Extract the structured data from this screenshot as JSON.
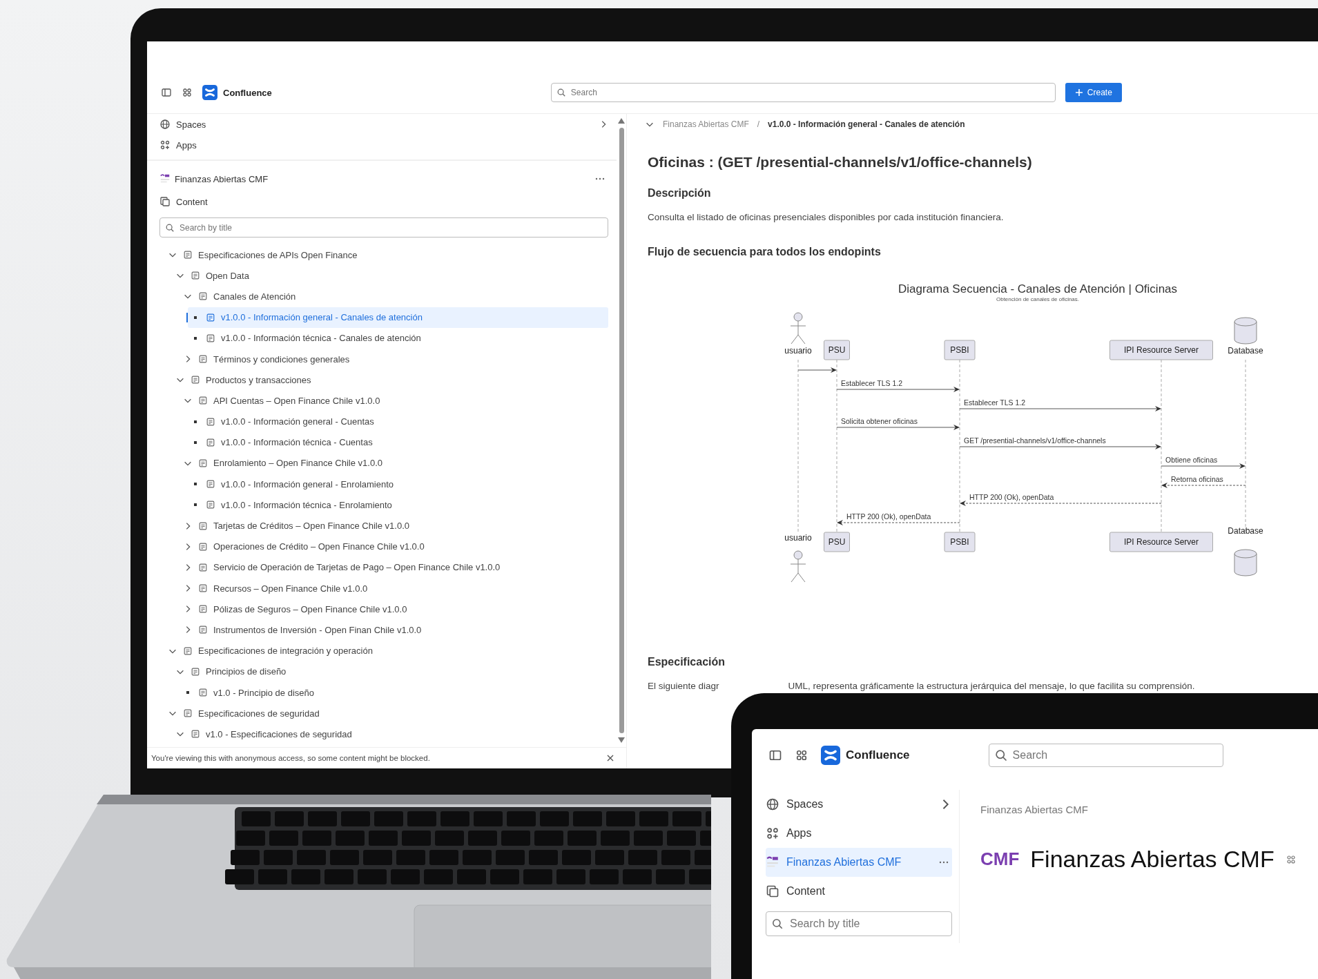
{
  "laptop": {
    "header": {
      "product": "Confluence",
      "search_placeholder": "Search",
      "create_label": "Create"
    },
    "sidebar": {
      "nav": [
        {
          "label": "Spaces",
          "kind": "spaces"
        },
        {
          "label": "Apps",
          "kind": "apps"
        }
      ],
      "space": {
        "name": "Finanzas Abiertas CMF",
        "selected": false
      },
      "content_label": "Content",
      "search_placeholder": "Search by title",
      "tree": [
        {
          "label": "Especificaciones de APIs Open Finance",
          "kind": "branch",
          "expanded": true,
          "selected": false,
          "children": [
            {
              "label": "Open Data",
              "kind": "branch",
              "expanded": true,
              "selected": false,
              "children": [
                {
                  "label": "Canales de Atención",
                  "kind": "branch",
                  "expanded": true,
                  "selected": false,
                  "children": [
                    {
                      "label": "v1.0.0 - Información general - Canales de atención",
                      "kind": "leaf",
                      "selected": true
                    },
                    {
                      "label": "v1.0.0 - Información técnica - Canales de atención",
                      "kind": "leaf",
                      "selected": false
                    }
                  ]
                },
                {
                  "label": "Términos y condiciones generales",
                  "kind": "branch",
                  "expanded": false,
                  "selected": false
                }
              ]
            },
            {
              "label": "Productos y transacciones",
              "kind": "branch",
              "expanded": true,
              "selected": false,
              "children": [
                {
                  "label": "API Cuentas – Open Finance Chile v1.0.0",
                  "kind": "branch",
                  "expanded": true,
                  "selected": false,
                  "children": [
                    {
                      "label": "v1.0.0 - Información general - Cuentas",
                      "kind": "leaf",
                      "selected": false
                    },
                    {
                      "label": "v1.0.0 - Información técnica - Cuentas",
                      "kind": "leaf",
                      "selected": false
                    }
                  ]
                },
                {
                  "label": "Enrolamiento – Open Finance Chile v1.0.0",
                  "kind": "branch",
                  "expanded": true,
                  "selected": false,
                  "children": [
                    {
                      "label": "v1.0.0 - Información general - Enrolamiento",
                      "kind": "leaf",
                      "selected": false
                    },
                    {
                      "label": "v1.0.0 - Información técnica - Enrolamiento",
                      "kind": "leaf",
                      "selected": false
                    }
                  ]
                },
                {
                  "label": "Tarjetas de Créditos – Open Finance Chile v1.0.0",
                  "kind": "branch",
                  "expanded": false,
                  "selected": false
                },
                {
                  "label": "Operaciones de Crédito – Open Finance Chile v1.0.0",
                  "kind": "branch",
                  "expanded": false,
                  "selected": false
                },
                {
                  "label": "Servicio de Operación de Tarjetas de Pago – Open Finance Chile v1.0.0",
                  "kind": "branch",
                  "expanded": false,
                  "selected": false
                },
                {
                  "label": "Recursos – Open Finance Chile v1.0.0",
                  "kind": "branch",
                  "expanded": false,
                  "selected": false
                },
                {
                  "label": "Pólizas de Seguros – Open Finance Chile v1.0.0",
                  "kind": "branch",
                  "expanded": false,
                  "selected": false
                },
                {
                  "label": "Instrumentos de Inversión - Open Finan Chile v1.0.0",
                  "kind": "branch",
                  "expanded": false,
                  "selected": false
                }
              ]
            }
          ]
        },
        {
          "label": "Especificaciones de integración y operación",
          "kind": "branch",
          "expanded": true,
          "selected": false,
          "children": [
            {
              "label": "Principios de diseño",
              "kind": "branch",
              "expanded": true,
              "selected": false,
              "children": [
                {
                  "label": "v1.0 - Principio de diseño",
                  "kind": "leaf",
                  "selected": false
                }
              ]
            }
          ]
        },
        {
          "label": "Especificaciones de seguridad",
          "kind": "branch",
          "expanded": true,
          "selected": false,
          "children": [
            {
              "label": "v1.0 - Especificaciones de seguridad",
              "kind": "branch",
              "expanded": true,
              "selected": false
            }
          ]
        }
      ],
      "banner": "You're viewing this with anonymous access, so some content might be blocked."
    },
    "breadcrumb": [
      "Finanzas Abiertas CMF",
      "v1.0.0 - Información general - Canales de atención"
    ],
    "breadcrumb_separator": "/",
    "page": {
      "title": "Oficinas : (GET /presential-channels/v1/office-channels)",
      "sections": [
        {
          "kind": "heading",
          "text": "Descripción"
        },
        {
          "kind": "paragraph",
          "text": "Consulta el listado de oficinas presenciales disponibles por cada institución financiera."
        },
        {
          "kind": "heading",
          "text": "Flujo de secuencia para todos los endopints"
        },
        {
          "kind": "diagram"
        },
        {
          "kind": "heading",
          "text": "Especificación"
        },
        {
          "kind": "covered",
          "parts": [
            "El siguiente diagr",
            "UML, representa gráficamente la estructura jerárquica del mensaje, lo que facilita su comprensión."
          ]
        }
      ]
    },
    "diagram": {
      "title": "Diagrama Secuencia - Canales de Atención | Oficinas",
      "subtitle": "Obtención de canales de oficinas.",
      "participants": [
        {
          "kind": "actor",
          "top": "usuario",
          "bottom": "usuario"
        },
        {
          "kind": "box",
          "top": "PSU",
          "bottom": "PSU"
        },
        {
          "kind": "box",
          "top": "PSBI",
          "bottom": "PSBI"
        },
        {
          "kind": "box",
          "top": "IPI Resource Server",
          "bottom": "IPI Resource Server"
        },
        {
          "kind": "database",
          "top": "Database",
          "bottom": "Database"
        }
      ],
      "messages": [
        {
          "kind": "sync"
        },
        {
          "kind": "sync",
          "label": "Establecer TLS 1.2"
        },
        {
          "kind": "sync",
          "label": "Establecer TLS 1.2"
        },
        {
          "kind": "sync",
          "label": "Solicita obtener oficinas"
        },
        {
          "kind": "sync",
          "label": "GET /presential-channels/v1/office-channels"
        },
        {
          "kind": "sync",
          "label": "Obtiene oficinas"
        },
        {
          "kind": "reply",
          "label": "Retorna oficinas"
        },
        {
          "kind": "reply",
          "label": "HTTP 200 (Ok), openData"
        },
        {
          "kind": "reply",
          "label": "HTTP 200 (Ok), openData"
        }
      ]
    }
  },
  "tablet": {
    "header": {
      "product": "Confluence",
      "search_placeholder": "Search"
    },
    "sidebar": {
      "nav": [
        {
          "label": "Spaces",
          "kind": "spaces"
        },
        {
          "label": "Apps",
          "kind": "apps"
        }
      ],
      "space": {
        "name": "Finanzas Abiertas CMF",
        "selected": true
      },
      "content_label": "Content",
      "search_placeholder": "Search by title"
    },
    "breadcrumb": "Finanzas Abiertas CMF",
    "logo_text": "CMF",
    "title": "Finanzas Abiertas CMF"
  }
}
